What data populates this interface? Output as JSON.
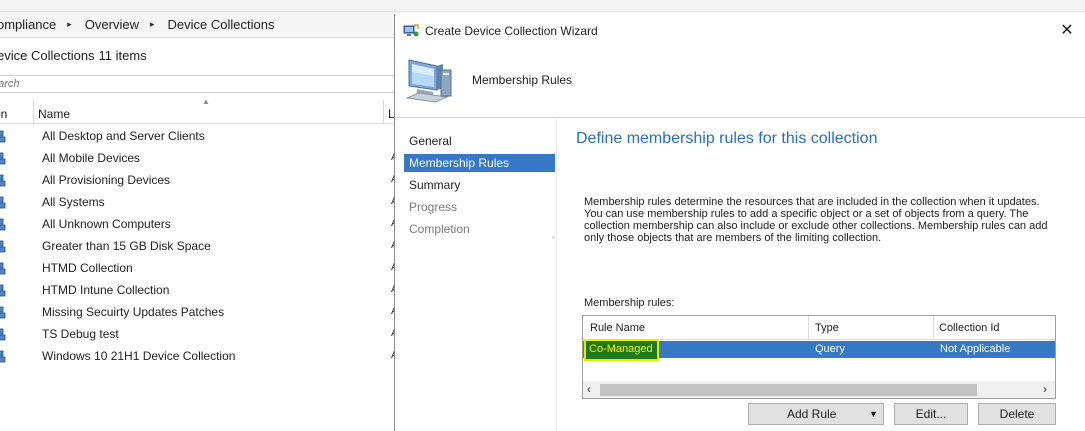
{
  "console": {
    "breadcrumb": [
      "ompliance",
      "Overview",
      "Device Collections"
    ],
    "breadcrumb_separator": "▸",
    "list_title": "evice Collections",
    "item_count": "11 items",
    "search_placeholder": "earch",
    "columns": {
      "icon": "on",
      "name": "Name",
      "extra": "L"
    },
    "rows": [
      {
        "name": "All Desktop and Server Clients",
        "trail": ""
      },
      {
        "name": "All Mobile Devices",
        "trail": "A"
      },
      {
        "name": "All Provisioning Devices",
        "trail": "A"
      },
      {
        "name": "All Systems",
        "trail": "A"
      },
      {
        "name": "All Unknown Computers",
        "trail": "A"
      },
      {
        "name": "Greater than 15 GB Disk Space",
        "trail": "A"
      },
      {
        "name": "HTMD Collection",
        "trail": "A"
      },
      {
        "name": "HTMD Intune Collection",
        "trail": "A"
      },
      {
        "name": "Missing Secuirty Updates Patches",
        "trail": "A"
      },
      {
        "name": "TS Debug test",
        "trail": "A"
      },
      {
        "name": "Windows 10 21H1 Device Collection",
        "trail": "A"
      }
    ]
  },
  "wizard": {
    "title": "Create Device Collection Wizard",
    "close_glyph": "✕",
    "page_name": "Membership Rules",
    "nav": [
      {
        "label": "General",
        "state": "normal"
      },
      {
        "label": "Membership Rules",
        "state": "active"
      },
      {
        "label": "Summary",
        "state": "normal"
      },
      {
        "label": "Progress",
        "state": "disabled"
      },
      {
        "label": "Completion",
        "state": "disabled"
      }
    ],
    "heading": "Define membership rules for this collection",
    "description": "Membership rules determine the resources that are included in the collection when it updates. You can use membership rules to add a specific object or a set of objects from a query. The collection membership can also include or exclude other collections. Membership rules can add only those objects that are members of the limiting collection.",
    "rules_label": "Membership rules:",
    "rules_table": {
      "headers": [
        "Rule Name",
        "Type",
        "Collection Id"
      ],
      "rows": [
        {
          "rule_name": "Co-Managed",
          "type": "Query",
          "collection_id": "Not Applicable"
        }
      ]
    },
    "buttons": {
      "add_rule": "Add Rule",
      "edit": "Edit...",
      "delete": "Delete"
    }
  },
  "colors": {
    "selection": "#3578c4",
    "heading": "#2a6fbc",
    "highlight_bg": "#1f7a1f",
    "highlight_text": "#f2f200"
  },
  "icons": [
    "device-collection-icon",
    "wizard-app-icon",
    "computer-icon",
    "close-icon",
    "sort-arrow-icon",
    "dropdown-caret-icon",
    "scroll-left-icon",
    "scroll-right-icon"
  ]
}
